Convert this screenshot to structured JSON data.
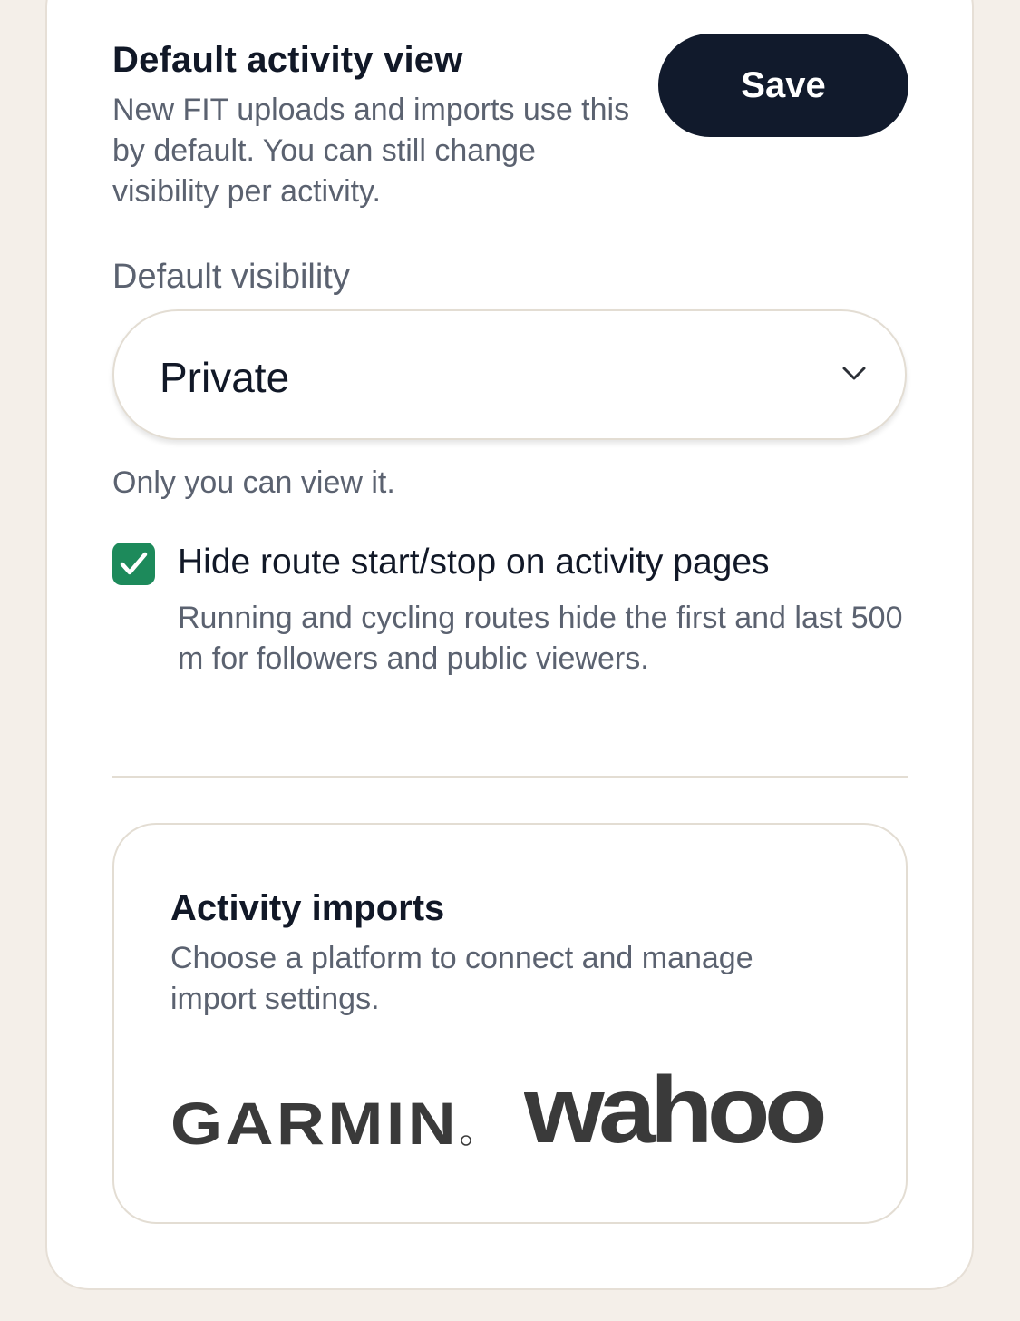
{
  "header": {
    "title": "Default activity view",
    "description": "New FIT uploads and imports use this by default. You can still change visibility per activity.",
    "save_label": "Save"
  },
  "visibility": {
    "label": "Default visibility",
    "selected": "Private",
    "helper": "Only you can view it."
  },
  "hide_route": {
    "checked": true,
    "label": "Hide route start/stop on activity pages",
    "description": "Running and cycling routes hide the first and last 500 m for followers and public viewers."
  },
  "imports": {
    "title": "Activity imports",
    "description": "Choose a platform to connect and manage import settings.",
    "platforms": [
      {
        "name": "GARMIN"
      },
      {
        "name": "wahoo"
      }
    ]
  },
  "colors": {
    "page_bg": "#f4efe9",
    "primary_button": "#111a2c",
    "checkbox_green": "#1d8a5b",
    "text_muted": "#5b6270",
    "logo_gray": "#3a3a3a"
  }
}
